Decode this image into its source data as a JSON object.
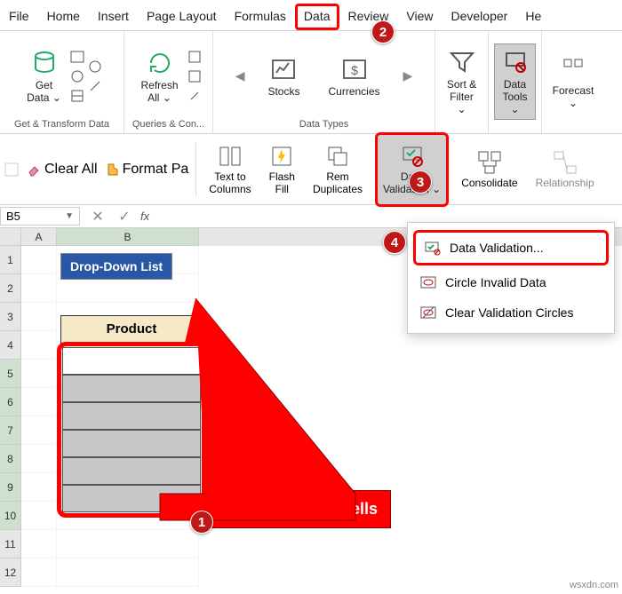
{
  "menu": {
    "tabs": [
      "File",
      "Home",
      "Insert",
      "Page Layout",
      "Formulas",
      "Data",
      "Review",
      "View",
      "Developer",
      "He"
    ],
    "active": "Data"
  },
  "ribbon": {
    "groups": [
      {
        "label": "Get & Transform Data",
        "buttons": [
          {
            "label": "Get\nData ⌄"
          }
        ]
      },
      {
        "label": "Queries & Con...",
        "buttons": [
          {
            "label": "Refresh\nAll ⌄"
          }
        ]
      },
      {
        "label": "Data Types",
        "buttons": [
          {
            "label": "Stocks"
          },
          {
            "label": "Currencies"
          }
        ],
        "nav": true
      },
      {
        "label": "",
        "buttons": [
          {
            "label": "Sort &\nFilter ⌄"
          }
        ]
      },
      {
        "label": "",
        "buttons": [
          {
            "label": "Data\nTools ⌄",
            "selected": true
          }
        ]
      },
      {
        "label": "",
        "buttons": [
          {
            "label": "Forecast\n⌄"
          }
        ]
      }
    ]
  },
  "ribbon2": {
    "clear_all": "Clear All",
    "format_pa": "Format Pa",
    "buttons": [
      {
        "name": "text-to-columns",
        "label": "Text to\nColumns"
      },
      {
        "name": "flash-fill",
        "label": "Flash\nFill"
      },
      {
        "name": "remove-duplicates",
        "label": "Rem\nDuplicates"
      },
      {
        "name": "data-validation",
        "label": "Data\nValidation ⌄",
        "highlighted": true
      },
      {
        "name": "consolidate",
        "label": "Consolidate"
      },
      {
        "name": "relationships",
        "label": "Relationship",
        "gray": true
      }
    ]
  },
  "namebox": {
    "ref": "B5",
    "fx": "fx"
  },
  "grid": {
    "colA": "A",
    "colB": "B",
    "rows": [
      1,
      2,
      3,
      4,
      5,
      6,
      7,
      8,
      9,
      10,
      11,
      12
    ],
    "title_chip": "Drop-Down List",
    "product_header": "Product"
  },
  "dropdown": {
    "items": [
      {
        "name": "data-validation",
        "label": "Data Validation...",
        "highlighted": true,
        "underline_index": 5
      },
      {
        "name": "circle-invalid",
        "label": "Circle Invalid Data"
      },
      {
        "name": "clear-circles",
        "label": "Clear Validation Circles"
      }
    ]
  },
  "callout": {
    "text": "Select multiple cells"
  },
  "badges": {
    "b1": "1",
    "b2": "2",
    "b3": "3",
    "b4": "4"
  },
  "watermark": "wsxdn.com"
}
